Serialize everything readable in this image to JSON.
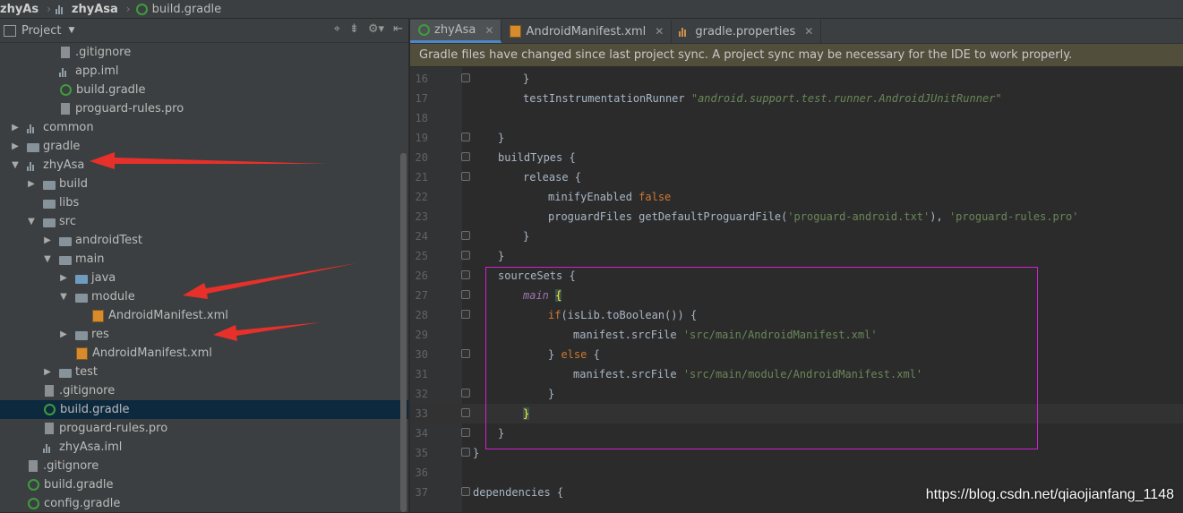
{
  "breadcrumb": [
    "zhyAs",
    "zhyAsa",
    "build.gradle"
  ],
  "project_panel": {
    "title": "Project",
    "tree": [
      {
        "label": ".gitignore",
        "depth": 2,
        "icon": "file-icon",
        "arrow": ""
      },
      {
        "label": "app.iml",
        "depth": 2,
        "icon": "module-file-icon",
        "arrow": ""
      },
      {
        "label": "build.gradle",
        "depth": 2,
        "icon": "gradle-icon",
        "arrow": ""
      },
      {
        "label": "proguard-rules.pro",
        "depth": 2,
        "icon": "file-icon",
        "arrow": ""
      },
      {
        "label": "common",
        "depth": 0,
        "icon": "module-icon",
        "arrow": "▶"
      },
      {
        "label": "gradle",
        "depth": 0,
        "icon": "folder-icon",
        "arrow": "▶"
      },
      {
        "label": "zhyAsa",
        "depth": 0,
        "icon": "module-icon",
        "arrow": "▼"
      },
      {
        "label": "build",
        "depth": 1,
        "icon": "folder-icon",
        "arrow": "▶"
      },
      {
        "label": "libs",
        "depth": 1,
        "icon": "folder-icon",
        "arrow": ""
      },
      {
        "label": "src",
        "depth": 1,
        "icon": "folder-icon",
        "arrow": "▼"
      },
      {
        "label": "androidTest",
        "depth": 2,
        "icon": "folder-icon",
        "arrow": "▶"
      },
      {
        "label": "main",
        "depth": 2,
        "icon": "folder-icon",
        "arrow": "▼"
      },
      {
        "label": "java",
        "depth": 3,
        "icon": "source-folder-icon",
        "arrow": "▶"
      },
      {
        "label": "module",
        "depth": 3,
        "icon": "folder-icon",
        "arrow": "▼"
      },
      {
        "label": "AndroidManifest.xml",
        "depth": 4,
        "icon": "xml-icon",
        "arrow": ""
      },
      {
        "label": "res",
        "depth": 3,
        "icon": "folder-icon",
        "arrow": "▶"
      },
      {
        "label": "AndroidManifest.xml",
        "depth": 3,
        "icon": "xml-icon",
        "arrow": ""
      },
      {
        "label": "test",
        "depth": 2,
        "icon": "folder-icon",
        "arrow": "▶"
      },
      {
        "label": ".gitignore",
        "depth": 1,
        "icon": "file-icon",
        "arrow": ""
      },
      {
        "label": "build.gradle",
        "depth": 1,
        "icon": "gradle-icon",
        "arrow": "",
        "selected": true
      },
      {
        "label": "proguard-rules.pro",
        "depth": 1,
        "icon": "file-icon",
        "arrow": ""
      },
      {
        "label": "zhyAsa.iml",
        "depth": 1,
        "icon": "module-file-icon",
        "arrow": ""
      },
      {
        "label": ".gitignore",
        "depth": 0,
        "icon": "file-icon",
        "arrow": ""
      },
      {
        "label": "build.gradle",
        "depth": 0,
        "icon": "gradle-icon",
        "arrow": ""
      },
      {
        "label": "config.gradle",
        "depth": 0,
        "icon": "gradle-icon",
        "arrow": ""
      }
    ]
  },
  "tabs": [
    {
      "label": "zhyAsa",
      "icon": "gradle-icon",
      "active": true
    },
    {
      "label": "AndroidManifest.xml",
      "icon": "xml-icon",
      "active": false
    },
    {
      "label": "gradle.properties",
      "icon": "properties-icon",
      "active": false
    }
  ],
  "notification": "Gradle files have changed since last project sync. A project sync may be necessary for the IDE to work properly.",
  "code_lines": [
    {
      "n": "16",
      "fold": true,
      "indent": 2,
      "parts": [
        [
          "}",
          ""
        ]
      ]
    },
    {
      "n": "17",
      "fold": false,
      "indent": 2,
      "parts": [
        [
          "testInstrumentationRunner ",
          ""
        ],
        [
          "\"android.support.test.runner.AndroidJUnitRunner\"",
          "str"
        ]
      ]
    },
    {
      "n": "18",
      "fold": false,
      "indent": 0,
      "parts": []
    },
    {
      "n": "19",
      "fold": true,
      "indent": 1,
      "parts": [
        [
          "}",
          ""
        ]
      ]
    },
    {
      "n": "20",
      "fold": true,
      "indent": 1,
      "parts": [
        [
          "buildTypes {",
          ""
        ]
      ]
    },
    {
      "n": "21",
      "fold": true,
      "indent": 2,
      "parts": [
        [
          "release {",
          ""
        ]
      ]
    },
    {
      "n": "22",
      "fold": false,
      "indent": 3,
      "parts": [
        [
          "minifyEnabled ",
          ""
        ],
        [
          "false",
          "kw"
        ]
      ]
    },
    {
      "n": "23",
      "fold": false,
      "indent": 3,
      "parts": [
        [
          "proguardFiles getDefaultProguardFile(",
          ""
        ],
        [
          "'proguard-android.txt'",
          "strn"
        ],
        [
          "), ",
          ""
        ],
        [
          "'proguard-rules.pro'",
          "strn"
        ]
      ]
    },
    {
      "n": "24",
      "fold": true,
      "indent": 2,
      "parts": [
        [
          "}",
          ""
        ]
      ]
    },
    {
      "n": "25",
      "fold": true,
      "indent": 1,
      "parts": [
        [
          "}",
          ""
        ]
      ]
    },
    {
      "n": "26",
      "fold": true,
      "indent": 1,
      "parts": [
        [
          "sourceSets {",
          ""
        ]
      ]
    },
    {
      "n": "27",
      "fold": true,
      "indent": 2,
      "parts": [
        [
          "main",
          "ital"
        ],
        [
          " ",
          ""
        ],
        [
          "{",
          "br"
        ]
      ]
    },
    {
      "n": "28",
      "fold": true,
      "indent": 3,
      "parts": [
        [
          "if",
          "kw"
        ],
        [
          "(isLib.toBoolean()) {",
          ""
        ]
      ]
    },
    {
      "n": "29",
      "fold": false,
      "indent": 4,
      "parts": [
        [
          "manifest.srcFile ",
          ""
        ],
        [
          "'src/main/AndroidManifest.xml'",
          "strn"
        ]
      ]
    },
    {
      "n": "30",
      "fold": true,
      "indent": 3,
      "parts": [
        [
          "} ",
          ""
        ],
        [
          "else",
          "kw"
        ],
        [
          " {",
          ""
        ]
      ]
    },
    {
      "n": "31",
      "fold": false,
      "indent": 4,
      "parts": [
        [
          "manifest.srcFile ",
          ""
        ],
        [
          "'src/main/module/AndroidManifest.xml'",
          "strn"
        ]
      ]
    },
    {
      "n": "32",
      "fold": true,
      "indent": 3,
      "parts": [
        [
          "}",
          ""
        ]
      ]
    },
    {
      "n": "33",
      "fold": true,
      "indent": 2,
      "parts": [
        [
          "}",
          "br"
        ]
      ],
      "current": true
    },
    {
      "n": "34",
      "fold": true,
      "indent": 1,
      "parts": [
        [
          "}",
          ""
        ]
      ]
    },
    {
      "n": "35",
      "fold": true,
      "indent": 0,
      "parts": [
        [
          "}",
          ""
        ]
      ]
    },
    {
      "n": "36",
      "fold": false,
      "indent": 0,
      "parts": []
    },
    {
      "n": "37",
      "fold": true,
      "indent": 0,
      "parts": [
        [
          "dependencies {",
          ""
        ]
      ]
    }
  ],
  "watermark": "https://blog.csdn.net/qiaojianfang_1148",
  "colors": {
    "annotation_arrow": "#e8302a",
    "highlight_box": "#d21fd2"
  }
}
